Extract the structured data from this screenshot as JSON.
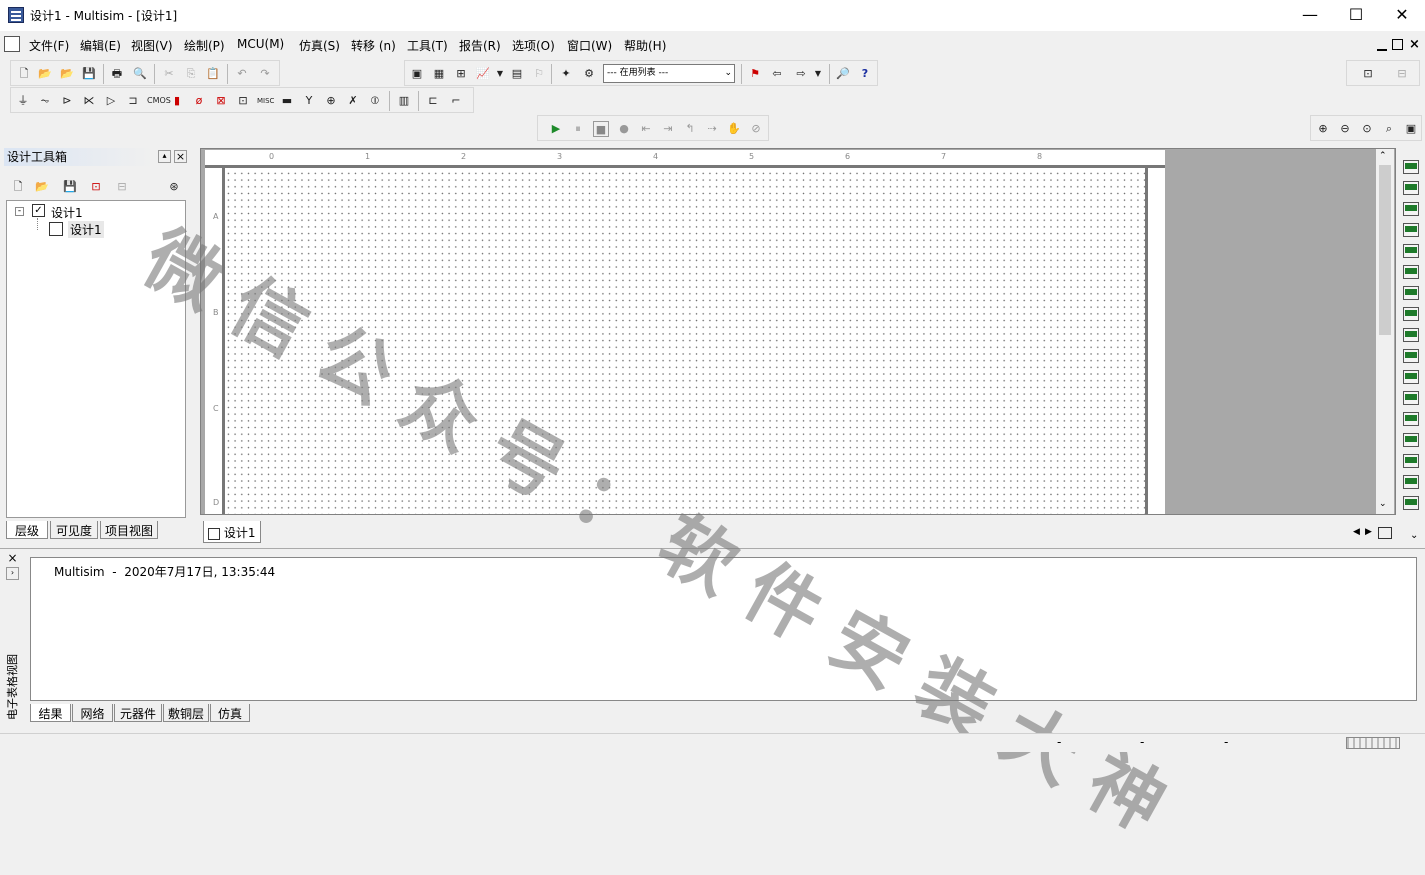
{
  "window": {
    "title": "设计1 - Multisim - [设计1]",
    "controls": [
      "—",
      "☐",
      "✕"
    ]
  },
  "menu": [
    {
      "label": "文件(F)"
    },
    {
      "label": "编辑(E)"
    },
    {
      "label": "视图(V)"
    },
    {
      "label": "绘制(P)"
    },
    {
      "label": "MCU(M)"
    },
    {
      "label": "仿真(S)"
    },
    {
      "label": "转移 (n)"
    },
    {
      "label": "工具(T)"
    },
    {
      "label": "报告(R)"
    },
    {
      "label": "选项(O)"
    },
    {
      "label": "窗口(W)"
    },
    {
      "label": "帮助(H)"
    }
  ],
  "toolbar": {
    "inuse_list_value": "--- 在用列表 ---"
  },
  "design_toolbox": {
    "title": "设计工具箱",
    "tree": [
      {
        "label": "设计1"
      },
      {
        "label": "设计1"
      }
    ],
    "tabs": [
      {
        "label": "层级"
      },
      {
        "label": "可见度"
      },
      {
        "label": "项目视图"
      }
    ]
  },
  "sheet": {
    "column_labels": [
      "0",
      "1",
      "2",
      "3",
      "4",
      "5",
      "6",
      "7",
      "8"
    ],
    "row_labels": [
      "A",
      "B",
      "C",
      "D"
    ],
    "tab_label": "设计1"
  },
  "results": {
    "side_title": "电子表格视图",
    "log_line": "Multisim  -  2020年7月17日, 13:35:44",
    "tabs": [
      {
        "label": "结果"
      },
      {
        "label": "网络"
      },
      {
        "label": "元器件"
      },
      {
        "label": "敷铜层"
      },
      {
        "label": "仿真"
      }
    ]
  },
  "watermark": "微信公众号：软件安装大神",
  "status": {
    "fields": [
      "-",
      "-",
      "-"
    ]
  }
}
